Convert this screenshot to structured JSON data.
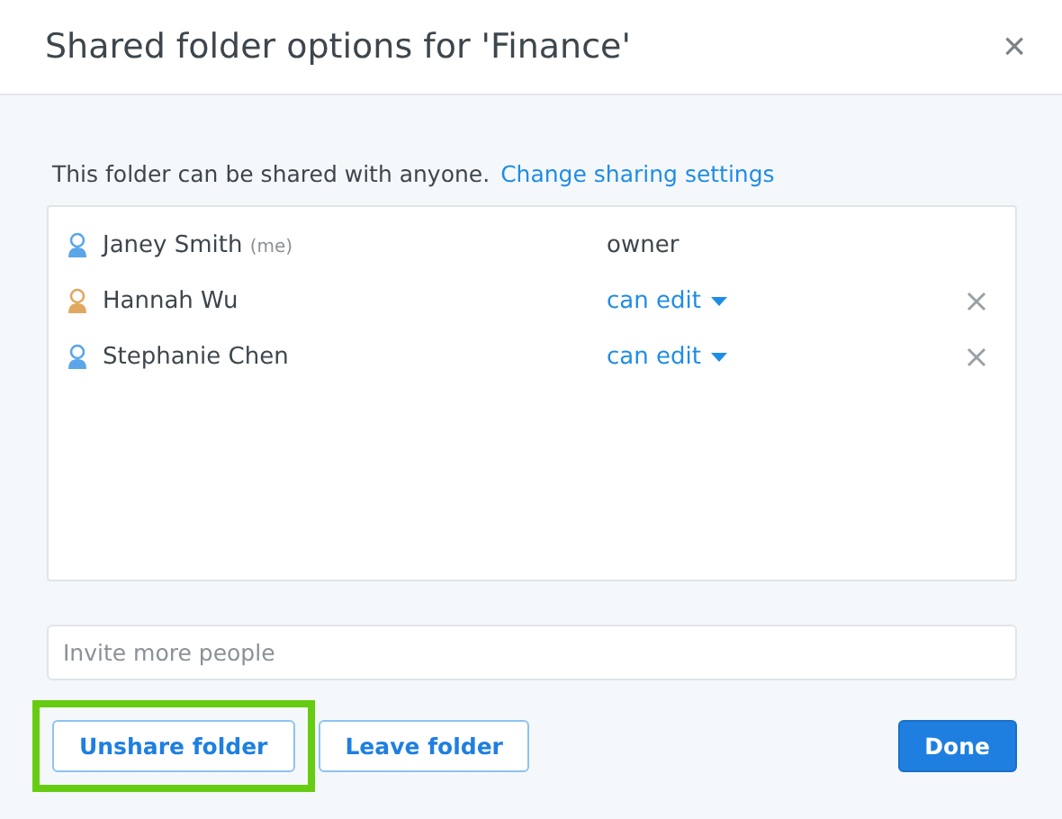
{
  "dialog": {
    "title": "Shared folder options for 'Finance'",
    "close": "×"
  },
  "notice": {
    "text": "This folder can be shared with anyone.",
    "link": "Change sharing settings"
  },
  "members": [
    {
      "name": "Janey Smith",
      "tag": "(me)",
      "role": "owner",
      "kind": "owner",
      "color": "#5aa6e8"
    },
    {
      "name": "Hannah Wu",
      "role": "can edit",
      "kind": "editor",
      "color": "#e0a860"
    },
    {
      "name": "Stephanie Chen",
      "role": "can edit",
      "kind": "editor",
      "color": "#5aa6e8"
    }
  ],
  "invite": {
    "placeholder": "Invite more people"
  },
  "buttons": [
    {
      "label": "Unshare folder",
      "kind": "secondary",
      "highlighted": true
    },
    {
      "label": "Leave folder",
      "kind": "secondary",
      "highlighted": false
    },
    {
      "label": "Done",
      "kind": "primary",
      "highlighted": false
    }
  ]
}
